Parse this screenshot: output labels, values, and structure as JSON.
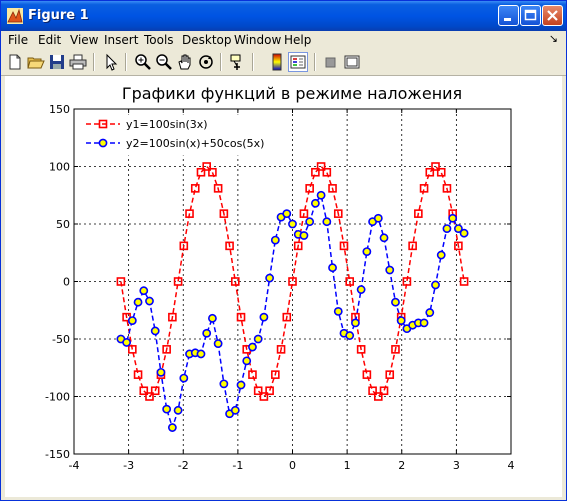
{
  "window": {
    "title": "Figure 1",
    "icon": "matlab-figure-icon"
  },
  "window_buttons": [
    "minimize",
    "maximize",
    "close"
  ],
  "menu": {
    "items": [
      "File",
      "Edit",
      "View",
      "Insert",
      "Tools",
      "Desktop",
      "Window",
      "Help"
    ],
    "dock_icon": "↘"
  },
  "toolbar": {
    "tools": [
      "new-figure",
      "open-file",
      "save",
      "print",
      "edit-plot",
      "zoom-in",
      "zoom-out",
      "pan",
      "rotate-3d",
      "data-cursor",
      "insert-colorbar",
      "insert-legend",
      "hide-plot-tools",
      "show-plot-tools"
    ],
    "pressed": "insert-legend"
  },
  "chart_data": {
    "type": "line",
    "title": "Графики функций в режиме наложения",
    "xlabel": "",
    "ylabel": "",
    "xlim": [
      -4,
      4
    ],
    "ylim": [
      -150,
      150
    ],
    "xticks": [
      "-4",
      "-3",
      "-2",
      "-1",
      "0",
      "1",
      "2",
      "3",
      "4"
    ],
    "yticks": [
      "-150",
      "-100",
      "-50",
      "0",
      "50",
      "100",
      "150"
    ],
    "grid": true,
    "grid_style": "dashed",
    "legend_position": "top-left",
    "x": [
      -3.1416,
      -3.0369,
      -2.9322,
      -2.8274,
      -2.7227,
      -2.618,
      -2.5133,
      -2.4086,
      -2.3038,
      -2.1991,
      -2.0944,
      -1.9897,
      -1.885,
      -1.7802,
      -1.6755,
      -1.5708,
      -1.4661,
      -1.3614,
      -1.2566,
      -1.1519,
      -1.0472,
      -0.9425,
      -0.8378,
      -0.733,
      -0.6283,
      -0.5236,
      -0.4189,
      -0.3142,
      -0.2094,
      -0.1047,
      0.0,
      0.1047,
      0.2094,
      0.3142,
      0.4189,
      0.5236,
      0.6283,
      0.733,
      0.8378,
      0.9425,
      1.0472,
      1.1519,
      1.2566,
      1.3614,
      1.4661,
      1.5708,
      1.6755,
      1.7802,
      1.885,
      1.9897,
      2.0944,
      2.1991,
      2.3038,
      2.4086,
      2.5133,
      2.618,
      2.7227,
      2.8274,
      2.9322,
      3.0369,
      3.1416
    ],
    "series": [
      {
        "name": "y1=100sin(3x)",
        "color": "#ff0000",
        "marker": "square",
        "line": "dashed",
        "marker_face": "none",
        "values": [
          0,
          -31,
          -59,
          -81,
          -95,
          -100,
          -95,
          -81,
          -59,
          -31,
          0,
          31,
          59,
          81,
          95,
          100,
          95,
          81,
          59,
          31,
          0,
          -31,
          -59,
          -81,
          -95,
          -100,
          -95,
          -81,
          -59,
          -31,
          0,
          31,
          59,
          81,
          95,
          100,
          95,
          81,
          59,
          31,
          0,
          -31,
          -59,
          -81,
          -95,
          -100,
          -95,
          -81,
          -59,
          -31,
          0,
          31,
          59,
          81,
          95,
          100,
          95,
          81,
          59,
          31,
          0
        ]
      },
      {
        "name": "y2=100sin(x)+50cos(5x)",
        "color": "#0000ff",
        "marker": "circle",
        "line": "dashed",
        "marker_face": "#ffff00",
        "values": [
          -50,
          -53,
          -34,
          -18,
          -8,
          -17,
          -43,
          -79,
          -111,
          -127,
          -112,
          -84,
          -63,
          -62,
          -63,
          -45,
          -32,
          -54,
          -89,
          -115,
          -112,
          -90,
          -69,
          -57,
          -50,
          -31,
          3,
          36,
          56,
          59,
          50,
          41,
          40,
          52,
          68,
          75,
          52,
          12,
          -26,
          -45,
          -47,
          -36,
          -7,
          26,
          52,
          55,
          38,
          10,
          -18,
          -34,
          -41,
          -38,
          -36,
          -36,
          -27,
          -3,
          23,
          46,
          55,
          46,
          42
        ]
      }
    ]
  }
}
